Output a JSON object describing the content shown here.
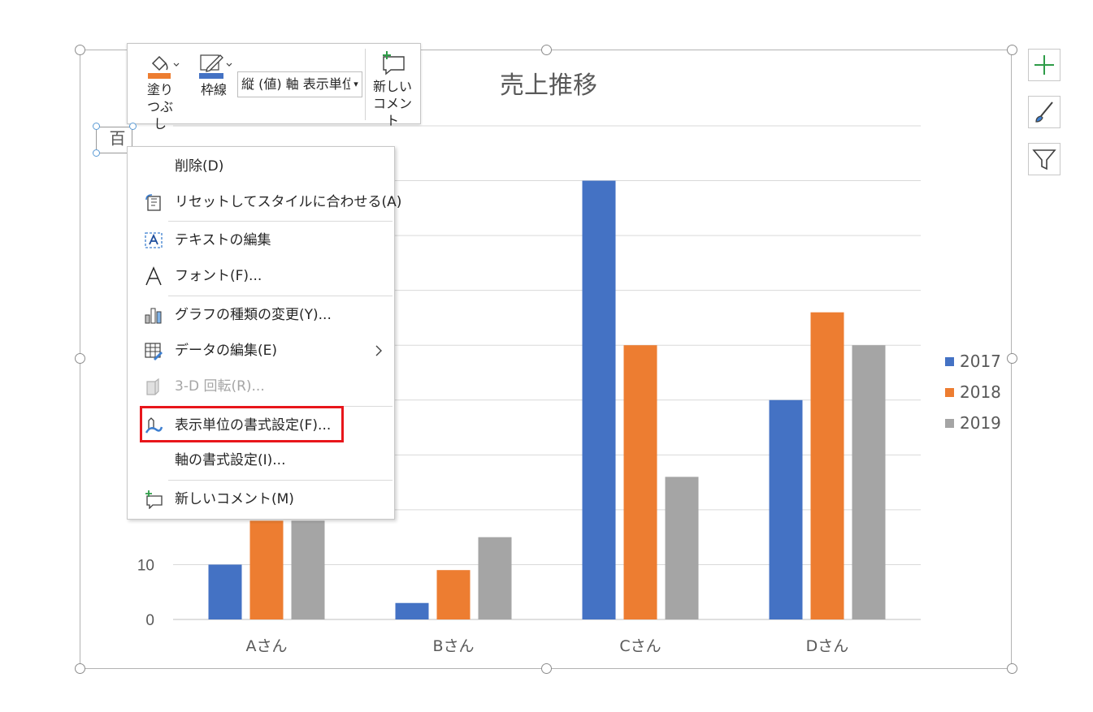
{
  "chart_data": {
    "type": "bar",
    "title": "売上推移",
    "categories": [
      "Aさん",
      "Bさん",
      "Cさん",
      "Dさん"
    ],
    "series": [
      {
        "name": "2017",
        "color": "#4472c4",
        "values": [
          10,
          3,
          80,
          40
        ]
      },
      {
        "name": "2018",
        "color": "#ed7d31",
        "values": [
          18,
          9,
          50,
          56
        ]
      },
      {
        "name": "2019",
        "color": "#a5a5a5",
        "values": [
          18,
          15,
          26,
          50
        ]
      }
    ],
    "ylim": [
      0,
      90
    ],
    "yticks_visible": [
      "0",
      "10"
    ],
    "grid": true,
    "legend_position": "right"
  },
  "toolbar": {
    "fill_label": "塗りつぶし",
    "outline_label": "枠線",
    "selector_value": "縦 (値) 軸 表示単位",
    "new_comment_label": "新しいコメント",
    "fill_color": "#ed7d31",
    "outline_color": "#4472c4"
  },
  "side_buttons": {
    "elements": "plus-icon",
    "styles": "brush-icon",
    "filters": "filter-icon"
  },
  "unit_label_text": "百",
  "context_menu": {
    "delete": "削除(D)",
    "reset_style": "リセットしてスタイルに合わせる(A)",
    "edit_text": "テキストの編集",
    "font": "フォント(F)...",
    "change_chart_type": "グラフの種類の変更(Y)...",
    "edit_data": "データの編集(E)",
    "rotation_3d": "3-D 回転(R)...",
    "format_display_units": "表示単位の書式設定(F)...",
    "format_axis": "軸の書式設定(I)...",
    "new_comment": "新しいコメント(M)"
  }
}
